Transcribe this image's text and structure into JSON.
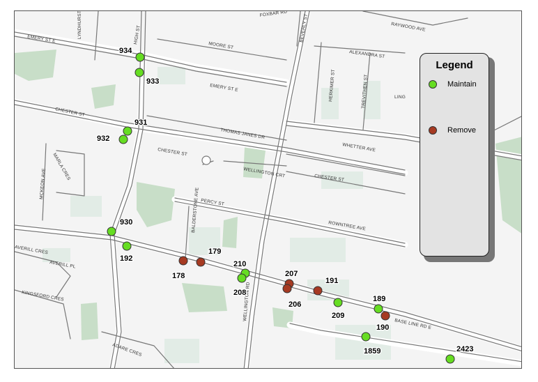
{
  "colors": {
    "maintain": "#66dd22",
    "remove": "#a63a22",
    "road": "#777777",
    "park": "#c8dec8",
    "building": "#e2ece6"
  },
  "legend": {
    "title": "Legend",
    "items": [
      {
        "label": "Maintain",
        "status": "maintain"
      },
      {
        "label": "Remove",
        "status": "remove"
      }
    ]
  },
  "streets": [
    "FOXBAR RD",
    "RAYWOOD AVE",
    "EMERY ST E",
    "LYNDHURST PL",
    "HIGH ST",
    "MOORE ST",
    "BEVERLY ST",
    "ALEXANDRA ST",
    "EMERY ST E",
    "HERKIMER ST",
    "TREVITHEN ST",
    "LING",
    "CHESTER ST",
    "THOMAS JANES DR",
    "WHETTER AVE",
    "THOMPSON RD",
    "MARLA CRES",
    "CHESTER ST",
    "WELLINGTON CRT",
    "CHESTER ST",
    "MCKEON AVE",
    "PERCY ST",
    "ROWNTREE AVE",
    "BALDERSTONE AVE",
    "AVERILL CRES",
    "AVERILL PL",
    "WELLINGTON RD",
    "KINGSFORD CRES",
    "BASE LINE RD E",
    "ADARE CRES",
    "IVE"
  ],
  "markers": [
    {
      "label": "934",
      "status": "maintain"
    },
    {
      "label": "933",
      "status": "maintain"
    },
    {
      "label": "931",
      "status": "maintain"
    },
    {
      "label": "932",
      "status": "maintain"
    },
    {
      "label": "930",
      "status": "maintain"
    },
    {
      "label": "192",
      "status": "maintain"
    },
    {
      "label": "178",
      "status": "remove"
    },
    {
      "label": "179",
      "status": "remove"
    },
    {
      "label": "210",
      "status": "maintain"
    },
    {
      "label": "208",
      "status": "maintain"
    },
    {
      "label": "207",
      "status": "remove"
    },
    {
      "label": "206",
      "status": "remove"
    },
    {
      "label": "191",
      "status": "remove"
    },
    {
      "label": "209",
      "status": "maintain"
    },
    {
      "label": "189",
      "status": "maintain"
    },
    {
      "label": "190",
      "status": "remove"
    },
    {
      "label": "1859",
      "status": "maintain"
    },
    {
      "label": "2423",
      "status": "maintain"
    }
  ]
}
